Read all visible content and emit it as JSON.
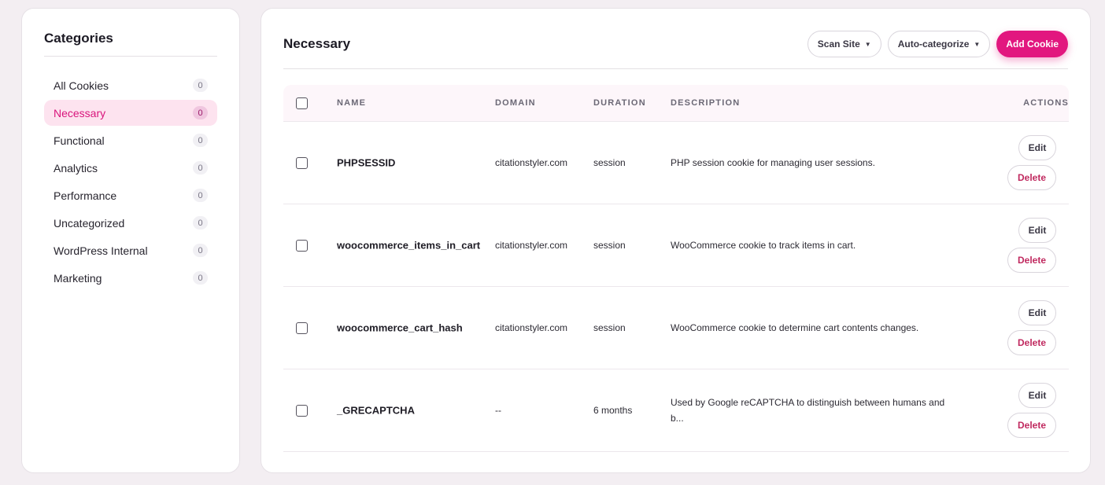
{
  "sidebar": {
    "title": "Categories",
    "items": [
      {
        "label": "All Cookies",
        "count": "0"
      },
      {
        "label": "Necessary",
        "count": "0"
      },
      {
        "label": "Functional",
        "count": "0"
      },
      {
        "label": "Analytics",
        "count": "0"
      },
      {
        "label": "Performance",
        "count": "0"
      },
      {
        "label": "Uncategorized",
        "count": "0"
      },
      {
        "label": "WordPress Internal",
        "count": "0"
      },
      {
        "label": "Marketing",
        "count": "0"
      }
    ]
  },
  "main": {
    "title": "Necessary",
    "toolbar": {
      "scan_label": "Scan Site",
      "auto_label": "Auto-categorize",
      "add_label": "Add Cookie"
    },
    "table": {
      "headers": {
        "name": "Name",
        "domain": "Domain",
        "duration": "Duration",
        "description": "Description",
        "actions": "Actions"
      },
      "edit_label": "Edit",
      "delete_label": "Delete",
      "rows": [
        {
          "name": "PHPSESSID",
          "domain": "citationstyler.com",
          "duration": "session",
          "description": "PHP session cookie for managing user sessions."
        },
        {
          "name": "woocommerce_items_in_cart",
          "domain": "citationstyler.com",
          "duration": "session",
          "description": "WooCommerce cookie to track items in cart."
        },
        {
          "name": "woocommerce_cart_hash",
          "domain": "citationstyler.com",
          "duration": "session",
          "description": "WooCommerce cookie to determine cart contents changes."
        },
        {
          "name": "_GRECAPTCHA",
          "domain": "--",
          "duration": "6 months",
          "description": "Used by Google reCAPTCHA to distinguish between humans and b..."
        }
      ]
    }
  },
  "colors": {
    "accent": "#e2177f",
    "active_bg": "#fde3ef",
    "delete_text": "#c0295f"
  },
  "icons": {
    "dropdown": "caret-down-icon",
    "select": "checkbox"
  }
}
